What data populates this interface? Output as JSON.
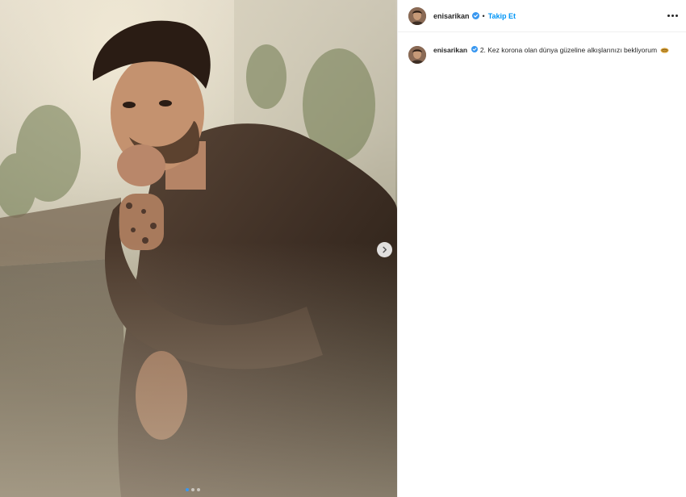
{
  "post": {
    "username": "enisarikan",
    "separator": "•",
    "follow_label": "Takip Et",
    "caption": "2. Kez korona olan dünya güzeline alkışlarınızı bekliyorum",
    "caption_emoji": "hand-emoji",
    "carousel": {
      "total": 3,
      "current": 1
    }
  },
  "icons": {
    "verified": "verified-badge-icon",
    "more": "more-options-icon",
    "next": "chevron-right-icon"
  },
  "colors": {
    "follow": "#0095f6",
    "verified": "#3897f0",
    "border": "#efefef"
  }
}
